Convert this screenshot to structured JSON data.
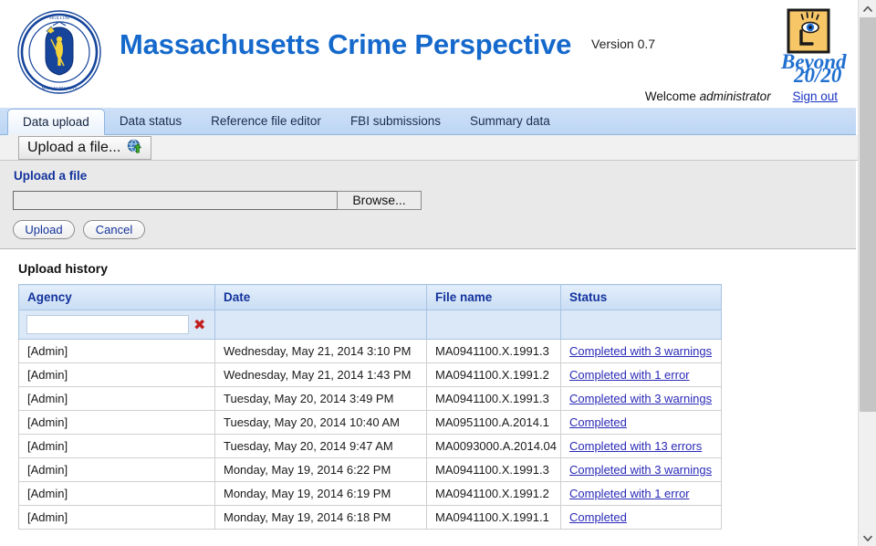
{
  "header": {
    "seal_icon": "massachusetts-state-seal",
    "app_title": "Massachusetts Crime Perspective",
    "version": "Version 0.7",
    "brand_logo_icon": "beyond-2020-logo",
    "brand_name_line1": "Beyond",
    "brand_name_line2": "20/20",
    "welcome_prefix": "Welcome",
    "username": "administrator",
    "signout_label": "Sign out"
  },
  "tabs": [
    {
      "label": "Data upload",
      "active": true
    },
    {
      "label": "Data status",
      "active": false
    },
    {
      "label": "Reference file editor",
      "active": false
    },
    {
      "label": "FBI submissions",
      "active": false
    },
    {
      "label": "Summary data",
      "active": false
    }
  ],
  "toolbar": {
    "upload_file_label": "Upload a file...",
    "upload_file_icon": "globe-upload-icon"
  },
  "upload_panel": {
    "title": "Upload a file",
    "file_input_value": "",
    "file_input_placeholder": "",
    "browse_label": "Browse...",
    "upload_label": "Upload",
    "cancel_label": "Cancel"
  },
  "history": {
    "title": "Upload history",
    "columns": [
      "Agency",
      "Date",
      "File name",
      "Status"
    ],
    "filter": {
      "agency_value": "",
      "clear_icon": "red-x-clear-icon"
    },
    "rows": [
      {
        "agency": "[Admin]",
        "date": "Wednesday, May 21, 2014 3:10 PM",
        "file": "MA0941100.X.1991.3",
        "status": "Completed with 3 warnings"
      },
      {
        "agency": "[Admin]",
        "date": "Wednesday, May 21, 2014 1:43 PM",
        "file": "MA0941100.X.1991.2",
        "status": "Completed with 1 error"
      },
      {
        "agency": "[Admin]",
        "date": "Tuesday, May 20, 2014 3:49 PM",
        "file": "MA0941100.X.1991.3",
        "status": "Completed with 3 warnings"
      },
      {
        "agency": "[Admin]",
        "date": "Tuesday, May 20, 2014 10:40 AM",
        "file": "MA0951100.A.2014.1",
        "status": "Completed"
      },
      {
        "agency": "[Admin]",
        "date": "Tuesday, May 20, 2014 9:47 AM",
        "file": "MA0093000.A.2014.04",
        "status": "Completed with 13 errors"
      },
      {
        "agency": "[Admin]",
        "date": "Monday, May 19, 2014 6:22 PM",
        "file": "MA0941100.X.1991.3",
        "status": "Completed with 3 warnings"
      },
      {
        "agency": "[Admin]",
        "date": "Monday, May 19, 2014 6:19 PM",
        "file": "MA0941100.X.1991.2",
        "status": "Completed with 1 error"
      },
      {
        "agency": "[Admin]",
        "date": "Monday, May 19, 2014 6:18 PM",
        "file": "MA0941100.X.1991.1",
        "status": "Completed"
      }
    ]
  },
  "scrollbar": {
    "up_icon": "chevron-up-icon",
    "down_icon": "chevron-down-icon"
  },
  "colors": {
    "title_blue": "#1569cc",
    "label_blue": "#13339c",
    "link_blue": "#2a2ab8",
    "tabbar_blue": "#bcd6f4",
    "table_header_blue": "#c9ddf4",
    "clear_red": "#c2201e"
  }
}
